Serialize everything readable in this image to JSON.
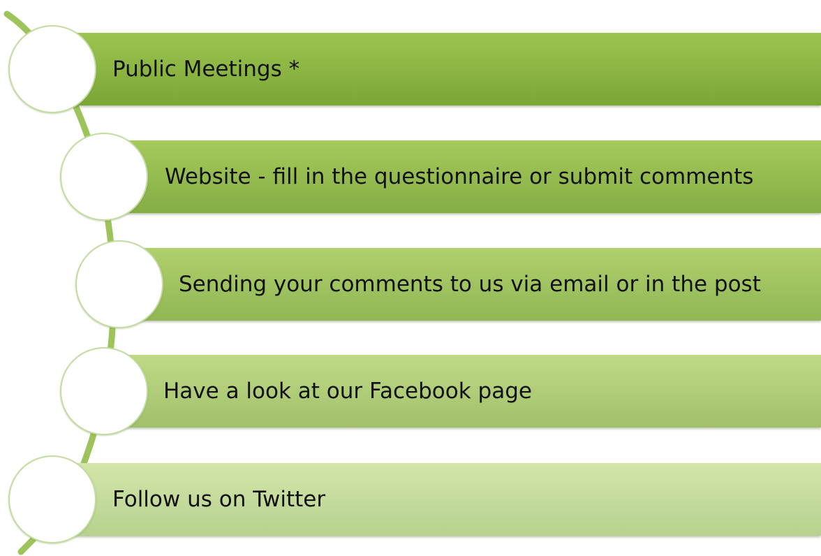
{
  "items": [
    {
      "label": "Public Meetings *"
    },
    {
      "label": "Website - fill in the questionnaire or submit comments"
    },
    {
      "label": "Sending your comments to us via email or in the post"
    },
    {
      "label": "Have a look at our Facebook page"
    },
    {
      "label": "Follow us on Twitter"
    }
  ],
  "colors": {
    "connector": "#9dc45a",
    "node_border": "#c3dca0",
    "bar_gradients": [
      [
        "#9dc450",
        "#7ba636"
      ],
      [
        "#a6ca5c",
        "#84ad44"
      ],
      [
        "#b0d06c",
        "#91b655"
      ],
      [
        "#c0da86",
        "#a1c06c"
      ],
      [
        "#d3e6a8",
        "#b6d18f"
      ]
    ]
  }
}
